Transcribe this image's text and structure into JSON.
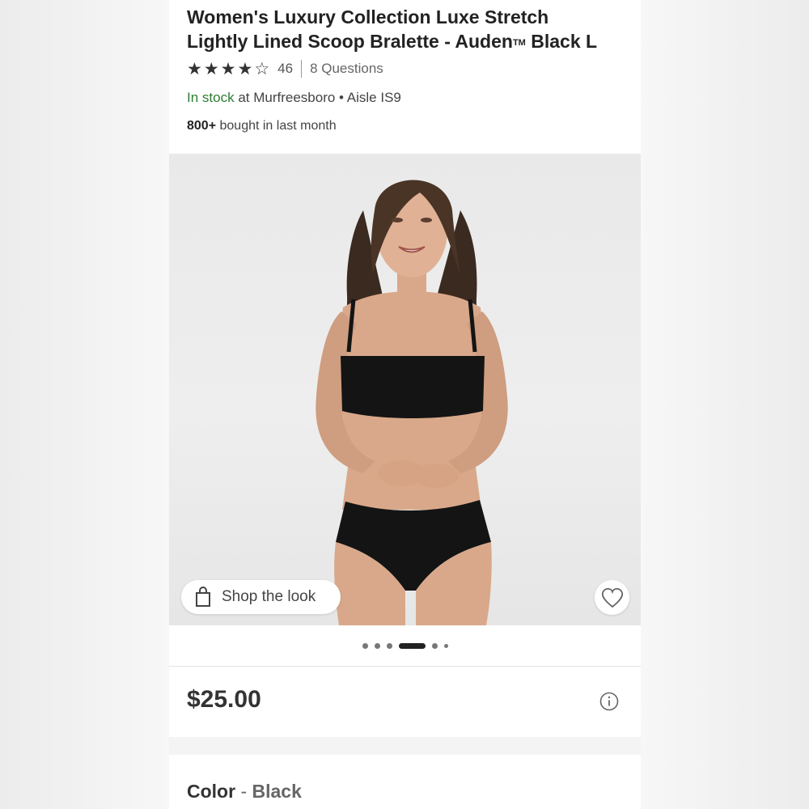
{
  "product": {
    "title_line1": "Women's Luxury Collection Luxe Stretch",
    "title_line2_pre": "Lightly Lined Scoop Bralette - Auden",
    "title_tm": "TM",
    "title_line2_post": " Black L",
    "rating": 4,
    "rating_max": 5,
    "review_count": "46",
    "questions": "8 Questions",
    "stock_status": "In stock",
    "stock_location": " at Murfreesboro • Aisle IS9",
    "bought_count": "800+",
    "bought_text": " bought in last month"
  },
  "gallery": {
    "shop_the_look": "Shop the look",
    "dot_count": 6,
    "active_dot": 3
  },
  "pricing": {
    "price": "$25.00"
  },
  "variant": {
    "color_label": "Color",
    "color_separator": " - ",
    "color_value": "Black"
  },
  "icons": {
    "star": "star-icon",
    "bag": "shopping-bag-icon",
    "heart": "heart-icon",
    "info": "info-icon"
  },
  "colors": {
    "in_stock": "#2e7d32",
    "text_dark": "#222222",
    "garment": "#141414"
  }
}
